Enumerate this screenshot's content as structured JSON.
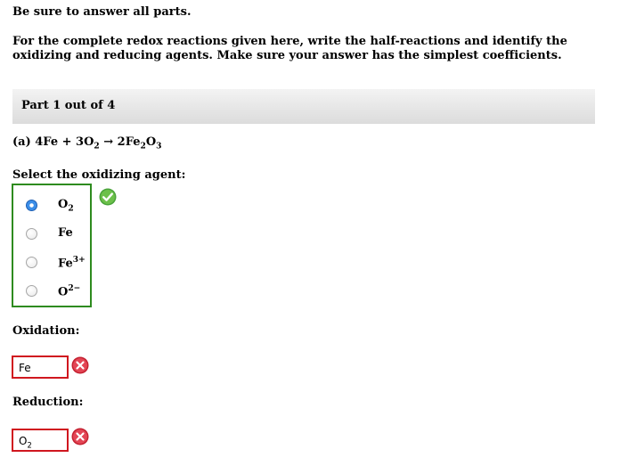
{
  "instructions": "Be sure to answer all parts.",
  "prompt": "For the complete redox reactions given here, write the half-reactions and identify the oxidizing and reducing agents. Make sure your answer has the simplest coefficients.",
  "part_label": "Part 1 out of 4",
  "reaction": {
    "prefix": "(a) 4Fe + 3O",
    "o2_sub": "2",
    "arrow": " → 2Fe",
    "fe_sub": "2",
    "o": "O",
    "o_sub": "3"
  },
  "select_question": "Select the oxidizing agent:",
  "options": [
    {
      "base": "O",
      "sub": "2",
      "sup": "",
      "selected": true
    },
    {
      "base": "Fe",
      "sub": "",
      "sup": "",
      "selected": false
    },
    {
      "base": "Fe",
      "sub": "",
      "sup": "3+",
      "selected": false
    },
    {
      "base": "O",
      "sub": "",
      "sup": "2−",
      "selected": false
    }
  ],
  "oxidation_label": "Oxidation:",
  "oxidation_value": "Fe",
  "reduction_label": "Reduction:",
  "reduction_value": {
    "base": "O",
    "sub": "2"
  },
  "colors": {
    "correct": "#2e8b1f",
    "incorrect": "#d0171f"
  },
  "icons": {
    "correct": "check-circle-icon",
    "incorrect": "x-circle-icon"
  }
}
